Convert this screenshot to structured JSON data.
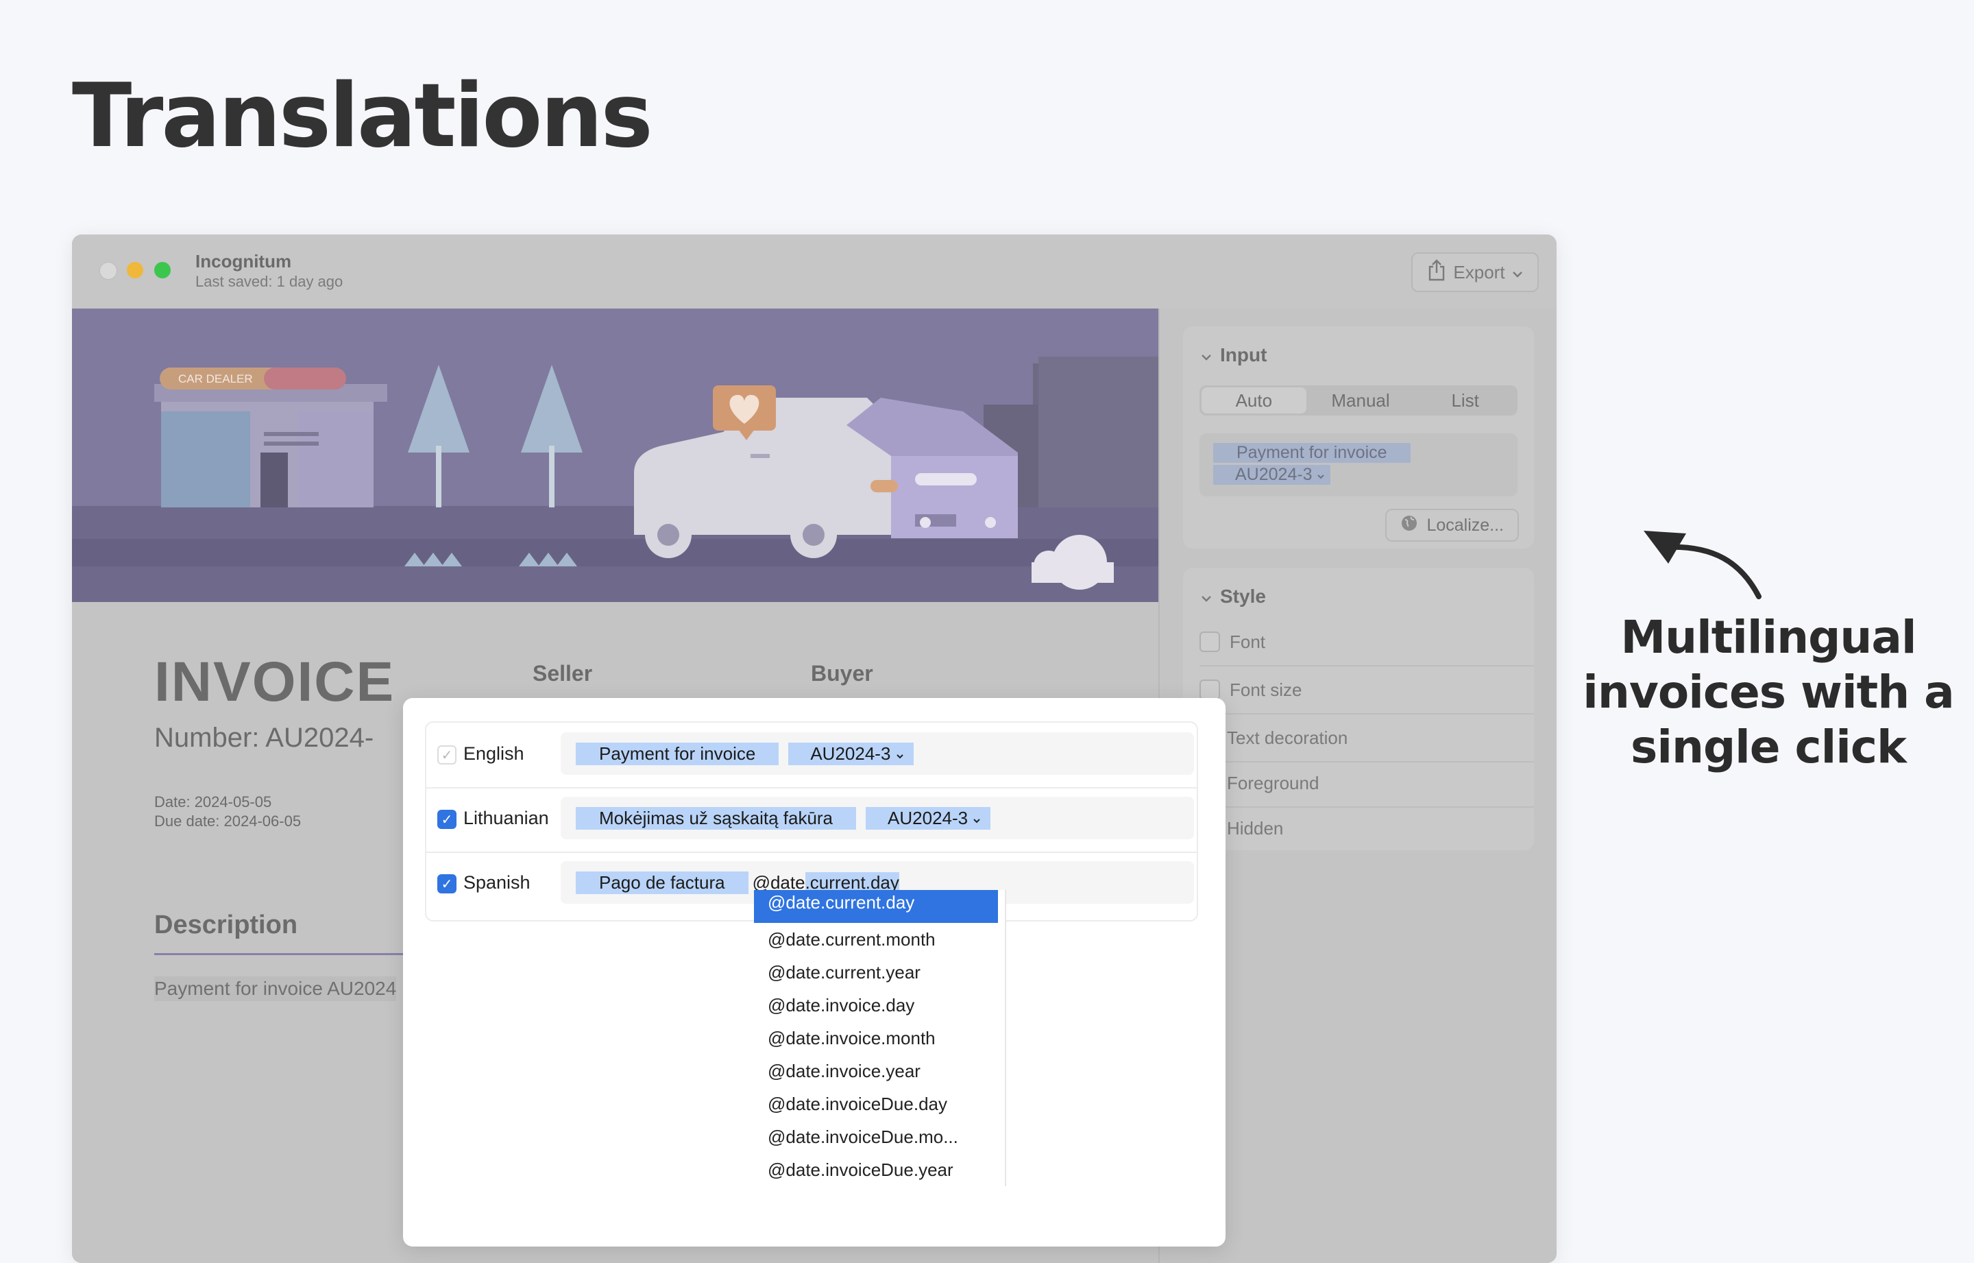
{
  "page": {
    "title": "Translations",
    "tagline": "Multilingual invoices with a single click"
  },
  "window": {
    "app_name": "Incognitum",
    "last_saved": "Last saved: 1 day ago",
    "export_label": "Export"
  },
  "banner": {
    "sign_text": "CAR DEALER"
  },
  "invoice": {
    "title": "INVOICE",
    "number": "Number:  AU2024-",
    "seller": "Seller",
    "buyer": "Buyer",
    "date": "Date: 2024-05-05",
    "due_date": "Due date: 2024-06-05",
    "description_heading": "Description",
    "description_text": "Payment for invoice AU2024"
  },
  "sidebar": {
    "input_heading": "Input",
    "segments": [
      "Auto",
      "Manual",
      "List"
    ],
    "active_segment": "Auto",
    "input_tokens": [
      "Payment for invoice",
      "AU2024-3"
    ],
    "localize_label": "Localize...",
    "style_heading": "Style",
    "style_options": [
      "Font",
      "Font size",
      "Text decoration",
      "Foreground",
      "Hidden"
    ]
  },
  "dialog": {
    "languages": [
      {
        "name": "English",
        "checked": true,
        "text": "Payment for invoice",
        "variable": "AU2024-3"
      },
      {
        "name": "Lithuanian",
        "checked": true,
        "text": "Mokėjimas už sąskaitą fakūra",
        "variable": "AU2024-3"
      },
      {
        "name": "Spanish",
        "checked": true,
        "text": "Pago de factura",
        "typed_prefix": "@date",
        "typed_highlight": ".current.day"
      }
    ],
    "autocomplete": [
      "@date.current.day",
      "@date.current.month",
      "@date.current.year",
      "@date.invoice.day",
      "@date.invoice.month",
      "@date.invoice.year",
      "@date.invoiceDue.day",
      "@date.invoiceDue.mo...",
      "@date.invoiceDue.year"
    ]
  },
  "colors": {
    "accent": "#2f74e0",
    "token_highlight": "#b9d4f8",
    "banner": "#7f7a9e"
  }
}
